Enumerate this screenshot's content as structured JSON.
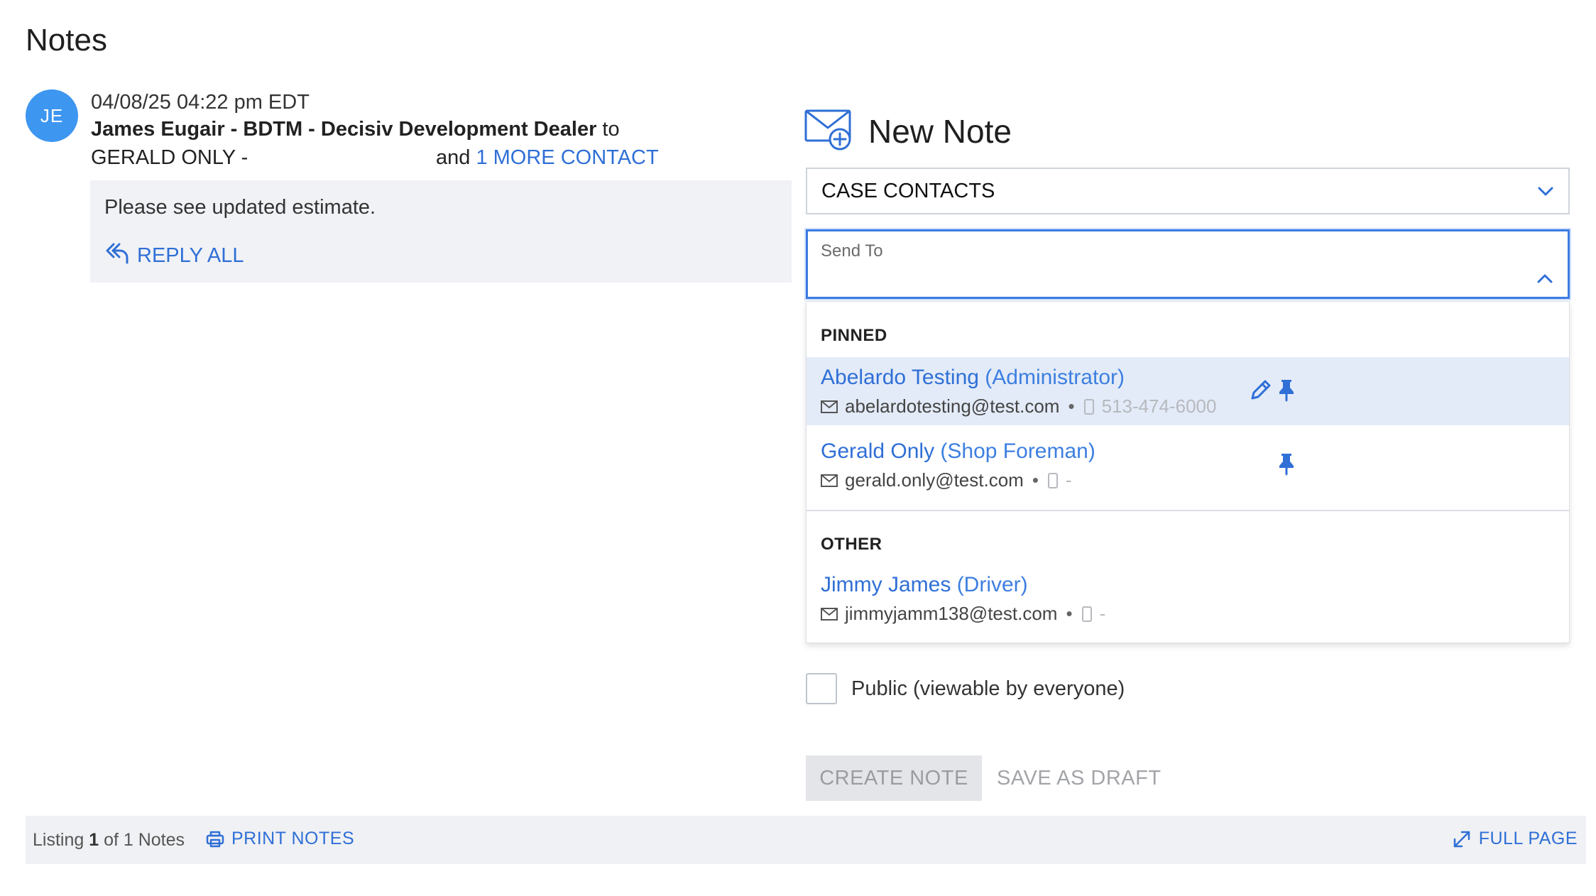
{
  "page": {
    "title": "Notes"
  },
  "note": {
    "avatar_initials": "JE",
    "date": "04/08/25 04:22 pm EDT",
    "author": "James Eugair - BDTM - Decisiv Development Dealer",
    "to_word": "to",
    "recipient": "GERALD ONLY -",
    "and_word": "and",
    "more_contacts": "1 MORE CONTACT",
    "body": "Please see updated estimate.",
    "reply_all_label": "REPLY ALL"
  },
  "new_note": {
    "title": "New Note",
    "contacts_select": "CASE CONTACTS",
    "send_to_label": "Send To",
    "dropdown": {
      "pinned_label": "PINNED",
      "other_label": "OTHER",
      "pinned": [
        {
          "name": "Abelardo Testing",
          "role": "(Administrator)",
          "email": "abelardotesting@test.com",
          "phone": "513-474-6000",
          "highlighted": true
        },
        {
          "name": "Gerald Only",
          "role": "(Shop Foreman)",
          "email": "gerald.only@test.com",
          "phone": "-",
          "highlighted": false
        }
      ],
      "other": [
        {
          "name": "Jimmy James",
          "role": "(Driver)",
          "email": "jimmyjamm138@test.com",
          "phone": "-"
        }
      ]
    },
    "public_label": "Public (viewable by everyone)",
    "create_label": "CREATE NOTE",
    "draft_label": "SAVE AS DRAFT"
  },
  "footer": {
    "listing_prefix": "Listing",
    "listing_current": "1",
    "listing_suffix": "of 1 Notes",
    "print_label": "PRINT NOTES",
    "full_page_label": "FULL PAGE"
  },
  "colors": {
    "accent": "#2f6fd6",
    "avatar": "#3d96f0",
    "highlight_row": "#e3ebf8",
    "focus_border": "#3b7be0"
  }
}
